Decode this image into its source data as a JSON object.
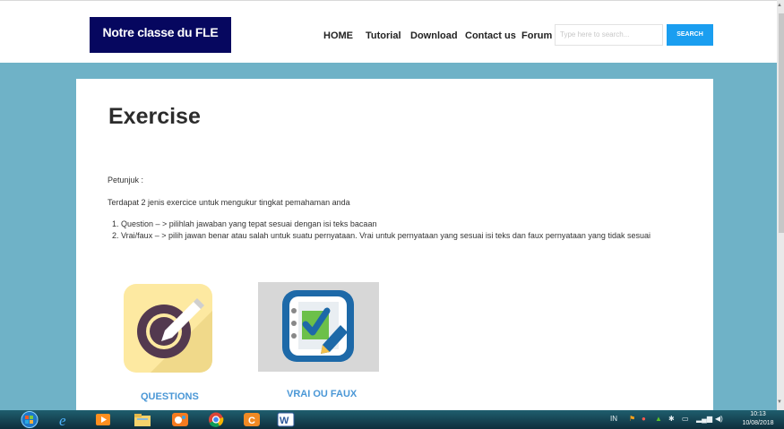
{
  "header": {
    "brand": "Notre classe du FLE",
    "nav": [
      "HOME",
      "Tutorial",
      "Download",
      "Contact us",
      "Forum"
    ],
    "search_placeholder": "Type here to search...",
    "search_button": "SEARCH"
  },
  "main": {
    "title": "Exercise",
    "petunjuk": "Petunjuk :",
    "intro": "Terdapat 2 jenis exercice untuk mengukur tingkat pemahaman anda",
    "steps": [
      "1. Question – > pilihlah jawaban yang tepat sesuai dengan isi teks bacaan",
      "2. Vrai/faux – > pilih jawan benar atau salah untuk suatu pernyataan. Vrai untuk pernyataan yang sesuai isi teks dan faux pernyataan yang tidak sesuai"
    ],
    "cards": [
      {
        "label": "QUESTIONS"
      },
      {
        "label": "VRAI OU FAUX"
      }
    ]
  },
  "taskbar": {
    "lang": "IN",
    "time": "10:13",
    "date": "10/08/2018"
  },
  "colors": {
    "brand_bg": "#06075f",
    "accent_blue": "#1a9ef0",
    "page_bg": "#6fb2c7",
    "link_blue": "#4a97d6"
  }
}
